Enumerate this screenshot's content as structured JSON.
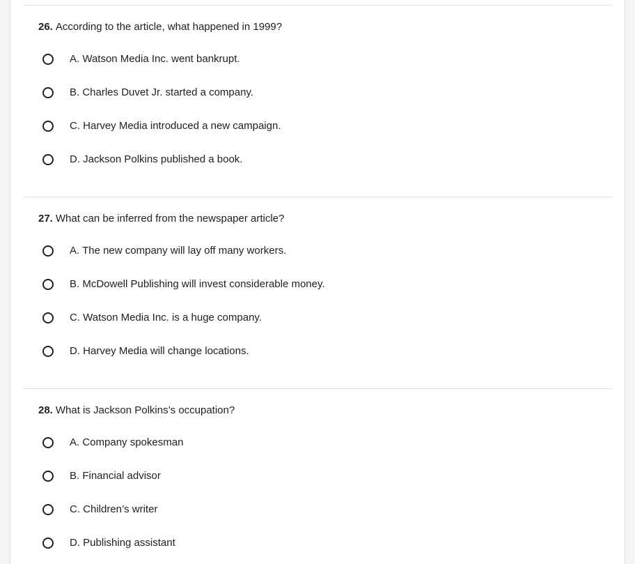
{
  "questions": [
    {
      "number": "26.",
      "text": "According to the article, what happened in 1999?",
      "options": [
        "A. Watson Media Inc. went bankrupt.",
        "B. Charles Duvet Jr. started a company.",
        "C. Harvey Media introduced a new campaign.",
        "D. Jackson Polkins published a book."
      ]
    },
    {
      "number": "27.",
      "text": "What can be inferred from the newspaper article?",
      "options": [
        "A. The new company will lay off many workers.",
        "B. McDowell Publishing will invest considerable money.",
        "C. Watson Media Inc. is a huge company.",
        "D. Harvey Media will change locations."
      ]
    },
    {
      "number": "28.",
      "text": "What is Jackson Polkins’s occupation?",
      "options": [
        "A. Company spokesman",
        "B. Financial advisor",
        "C. Children’s writer",
        "D. Publishing assistant"
      ]
    }
  ]
}
